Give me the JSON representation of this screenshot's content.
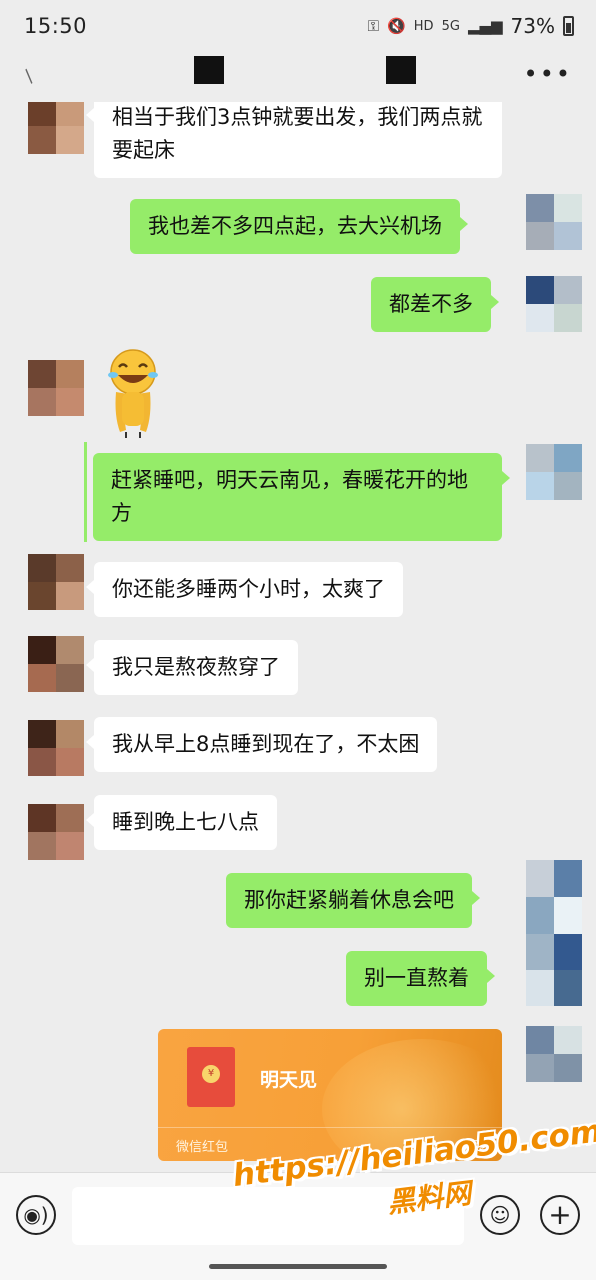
{
  "status_bar": {
    "time": "15:50",
    "network_hd": "HD",
    "network_5g": "5G",
    "battery_percent": "73%"
  },
  "header": {
    "back_icon": "pen-icon",
    "more_icon": "more-dots-icon",
    "more_glyph": "•••"
  },
  "messages": [
    {
      "direction": "in",
      "text": "相当于我们3点钟就要出发，我们两点就要起床"
    },
    {
      "direction": "out",
      "text": "我也差不多四点起，去大兴机场"
    },
    {
      "direction": "out",
      "text": "都差不多"
    },
    {
      "direction": "in",
      "type": "sticker",
      "sticker": "laughing-tears-emoji"
    },
    {
      "direction": "out",
      "text": "赶紧睡吧，明天云南见，春暖花开的地方"
    },
    {
      "direction": "in",
      "text": "你还能多睡两个小时，太爽了"
    },
    {
      "direction": "in",
      "text": "我只是熬夜熬穿了"
    },
    {
      "direction": "in",
      "text": "我从早上8点睡到现在了，不太困"
    },
    {
      "direction": "in",
      "text": "睡到晚上七八点"
    },
    {
      "direction": "out",
      "text": "那你赶紧躺着休息会吧"
    },
    {
      "direction": "out",
      "text": "别一直熬着"
    }
  ],
  "red_packet": {
    "title": "明天见",
    "label": "微信红包",
    "corner": "红包",
    "seal": "¥"
  },
  "input_bar": {
    "voice_glyph": "◉)",
    "emoji_glyph": "☺",
    "plus_glyph": "+"
  },
  "watermark": {
    "url": "https://heiliao50.com",
    "name": "黑料网"
  },
  "colors": {
    "incoming_bubble": "#ffffff",
    "outgoing_bubble": "#95ec69",
    "background": "#ededed",
    "red_packet": "#f7a037"
  }
}
